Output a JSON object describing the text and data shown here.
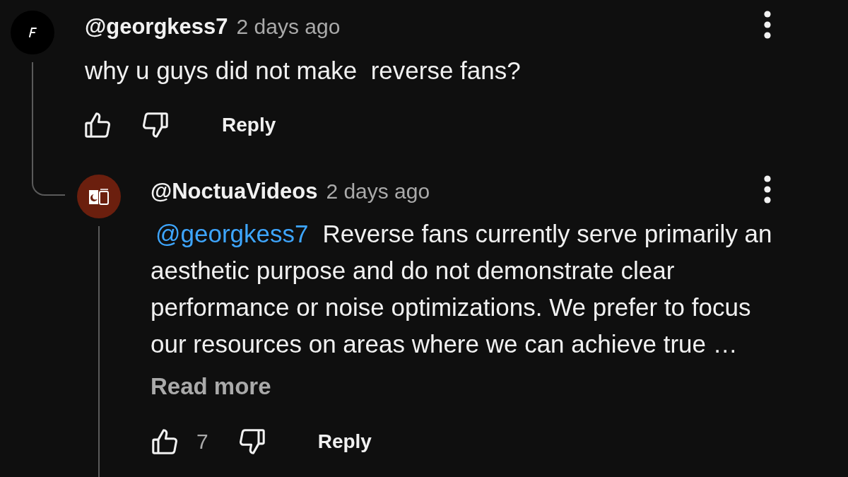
{
  "comments": [
    {
      "avatar": {
        "kind": "glyph",
        "color": "#000000"
      },
      "author": "@georgkess7",
      "time": "2 days ago",
      "text": "why u guys did not make  reverse fans?",
      "reply_label": "Reply",
      "replies": [
        {
          "avatar": {
            "kind": "logo",
            "color": "#6b1f0e"
          },
          "author": "@NoctuaVideos",
          "time": "2 days ago",
          "mention": "@georgkess7",
          "text": "Reverse fans currently serve primarily an aesthetic purpose and do not demonstrate clear performance or noise optimizations. We prefer to focus our resources on areas where we can achieve true …",
          "read_more": "Read more",
          "like_count": "7",
          "reply_label": "Reply"
        }
      ]
    }
  ]
}
